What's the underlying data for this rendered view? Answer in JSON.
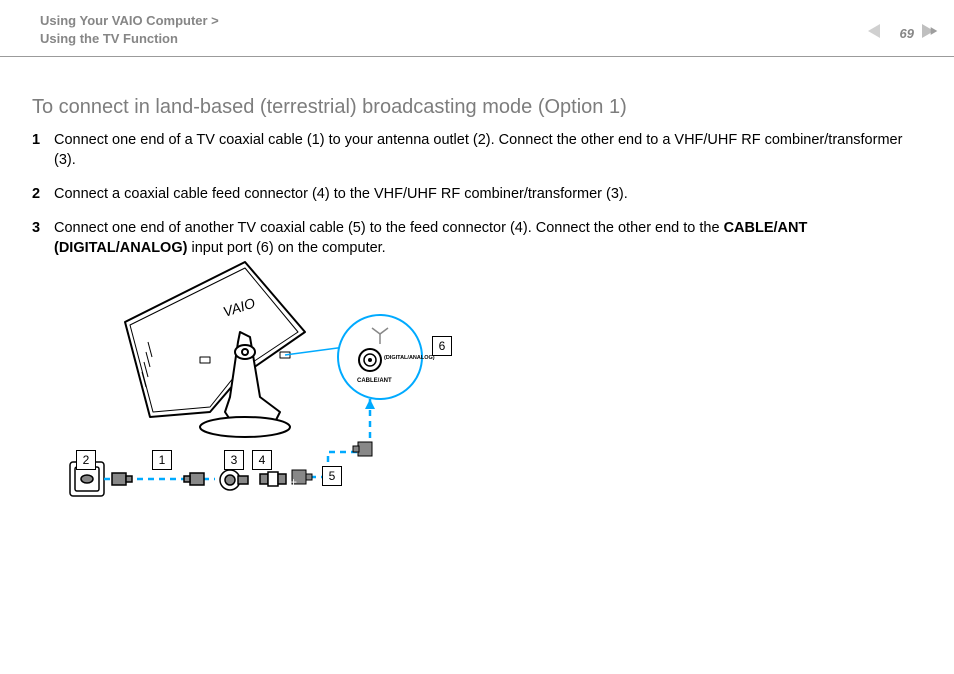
{
  "header": {
    "crumb_line1": "Using Your VAIO Computer >",
    "crumb_line2": "Using the TV Function",
    "page_number": "69"
  },
  "title": "To connect in land-based (terrestrial) broadcasting mode (Option 1)",
  "steps": [
    {
      "num": "1",
      "text_before": "Connect one end of a TV coaxial cable (1) to your antenna outlet (2). Connect the other end to a VHF/UHF RF combiner/transformer (3).",
      "bold": "",
      "text_after": ""
    },
    {
      "num": "2",
      "text_before": "Connect a coaxial cable feed connector (4) to the VHF/UHF RF combiner/transformer (3).",
      "bold": "",
      "text_after": ""
    },
    {
      "num": "3",
      "text_before": "Connect one end of another TV coaxial cable (5) to the feed connector (4). Connect the other end to the ",
      "bold": "CABLE/ANT (DIGITAL/ANALOG)",
      "text_after": " input port (6) on the computer."
    }
  ],
  "diagram": {
    "labels": {
      "n1": "1",
      "n2": "2",
      "n3": "3",
      "n4": "4",
      "n5": "5",
      "n6": "6"
    },
    "port_text_top": "(DIGITAL/ANALOG)",
    "port_text_bot": "CABLE/ANT",
    "monitor_logo": "VAIO"
  }
}
